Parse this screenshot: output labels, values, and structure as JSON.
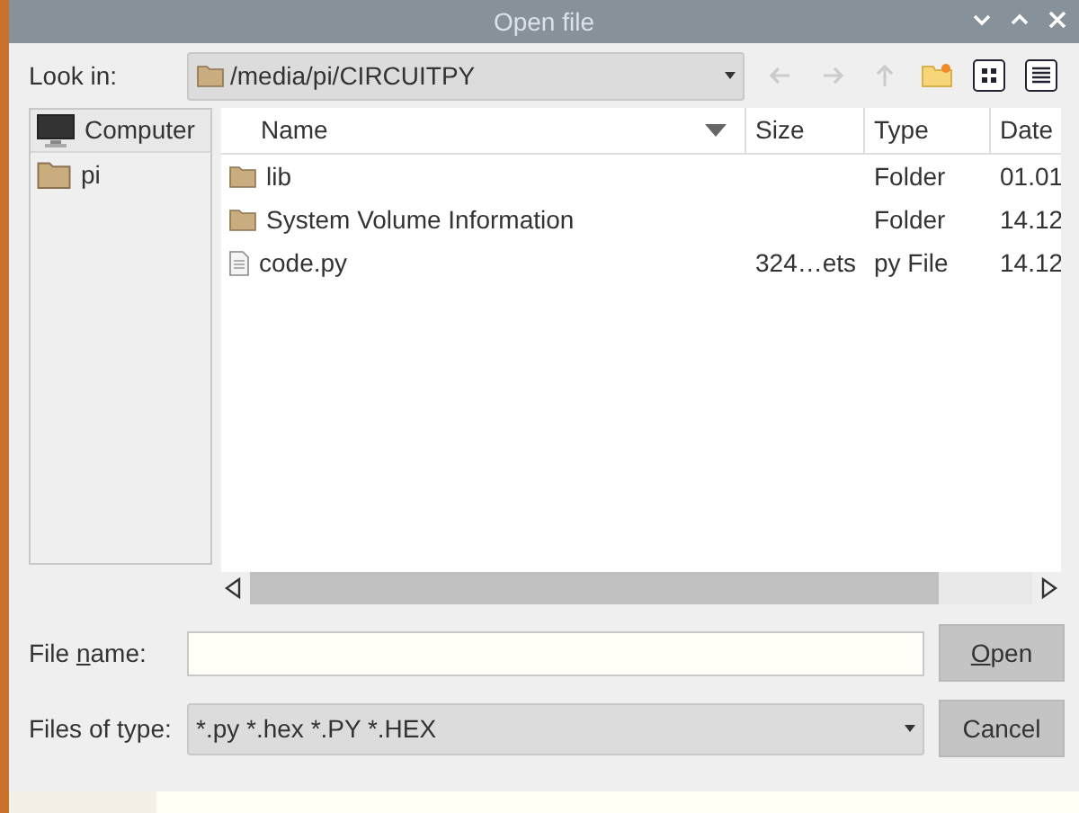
{
  "window": {
    "title": "Open file"
  },
  "look_in": {
    "label": "Look in:",
    "value": "/media/pi/CIRCUITPY"
  },
  "sidebar": {
    "items": [
      {
        "label": "Computer",
        "kind": "computer",
        "selected": true
      },
      {
        "label": "pi",
        "kind": "folder",
        "selected": false
      }
    ]
  },
  "table": {
    "columns": [
      "Name",
      "Size",
      "Type",
      "Date"
    ],
    "rows": [
      {
        "kind": "folder",
        "name": "lib",
        "size": "",
        "type": "Folder",
        "date": "01.01"
      },
      {
        "kind": "folder",
        "name": "System Volume Information",
        "size": "",
        "type": "Folder",
        "date": "14.12"
      },
      {
        "kind": "file",
        "name": "code.py",
        "size": "324…ets",
        "type": "py File",
        "date": "14.12"
      }
    ]
  },
  "file_name": {
    "label_parts": {
      "pre": "File ",
      "key": "n",
      "post": "ame:"
    }
  },
  "files_of_type": {
    "label": "Files of type:",
    "value": "*.py *.hex *.PY *.HEX"
  },
  "buttons": [
    {
      "label_parts": {
        "key": "O",
        "post": "pen"
      }
    },
    {
      "label_parts": {
        "pre": "Cancel"
      }
    }
  ]
}
